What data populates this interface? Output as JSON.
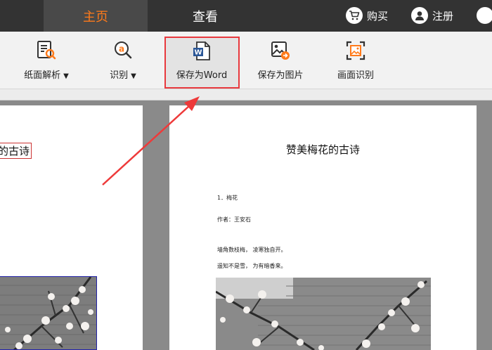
{
  "topbar": {
    "tabs": [
      {
        "label": "主页",
        "active": true
      },
      {
        "label": "查看",
        "active": false
      }
    ],
    "buy_label": "购买",
    "register_label": "注册"
  },
  "toolbar": {
    "items": [
      {
        "label": "纸面解析",
        "icon": "document-search-icon",
        "has_dropdown": true
      },
      {
        "label": "识别",
        "icon": "ocr-search-icon",
        "has_dropdown": true
      },
      {
        "label": "保存为Word",
        "icon": "word-file-icon",
        "has_dropdown": false
      },
      {
        "label": "保存为图片",
        "icon": "save-image-icon",
        "has_dropdown": false
      },
      {
        "label": "画面识别",
        "icon": "screen-capture-icon",
        "has_dropdown": false
      }
    ]
  },
  "left_page": {
    "title": "的古诗"
  },
  "right_page": {
    "title": "赞美梅花的古诗",
    "lines": [
      "1．梅花",
      "作者：王安石",
      "墙角数枝梅，   凌寒独自开。",
      "遥知不是雪，   为有暗香来。"
    ]
  },
  "colors": {
    "accent": "#ff7a1a",
    "highlight_border": "#e8383d",
    "topbar_bg": "#333333"
  }
}
